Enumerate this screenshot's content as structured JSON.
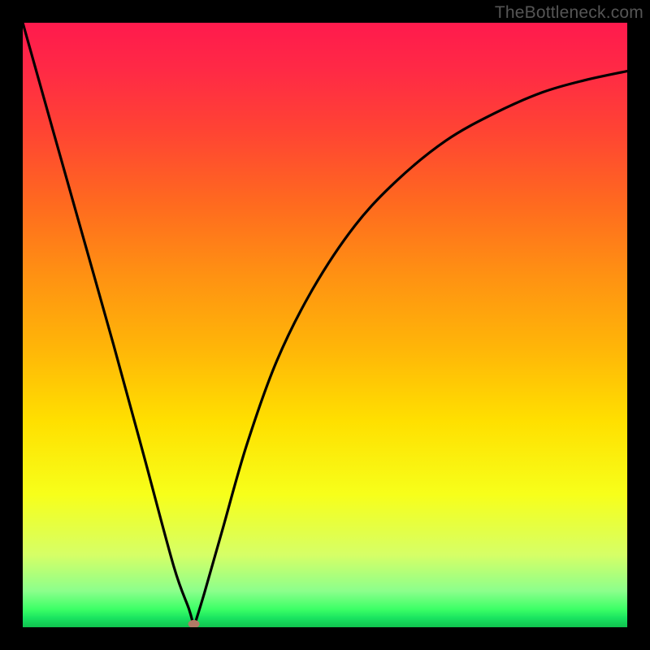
{
  "watermark": "TheBottleneck.com",
  "chart_data": {
    "type": "line",
    "title": "",
    "xlabel": "",
    "ylabel": "",
    "x_range": [
      0,
      1
    ],
    "y_range": [
      0,
      1
    ],
    "note": "V-shaped bottleneck curve on a red→green vertical gradient. Axes and tick labels are not rendered in the image, so x/y are normalized 0–1. Left branch is nearly linear and very steep; right branch rises with diminishing slope. Minimum sits at roughly x≈0.28 where the curve touches y≈0. Values below are read off the plotted curve in normalized coordinates.",
    "series": [
      {
        "name": "bottleneck-curve",
        "x": [
          0.0,
          0.05,
          0.1,
          0.15,
          0.2,
          0.25,
          0.275,
          0.283,
          0.3,
          0.33,
          0.37,
          0.42,
          0.48,
          0.55,
          0.62,
          0.7,
          0.78,
          0.86,
          0.93,
          1.0
        ],
        "y": [
          1.0,
          0.822,
          0.645,
          0.468,
          0.285,
          0.1,
          0.03,
          0.0,
          0.055,
          0.16,
          0.3,
          0.44,
          0.56,
          0.665,
          0.74,
          0.805,
          0.85,
          0.885,
          0.905,
          0.92
        ]
      }
    ],
    "minimum_marker": {
      "x": 0.283,
      "y": 0.0,
      "color": "#b17a66"
    },
    "background_gradient": {
      "direction": "top-to-bottom",
      "stops": [
        {
          "pos": 0.0,
          "color": "#ff1a4d"
        },
        {
          "pos": 0.3,
          "color": "#ff6a1f"
        },
        {
          "pos": 0.66,
          "color": "#ffe000"
        },
        {
          "pos": 0.94,
          "color": "#8cff8c"
        },
        {
          "pos": 1.0,
          "color": "#10c24f"
        }
      ]
    }
  }
}
